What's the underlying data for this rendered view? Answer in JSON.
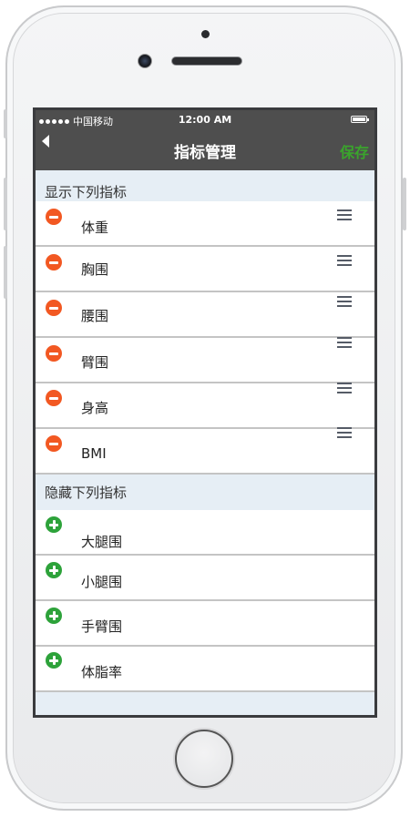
{
  "status_bar": {
    "carrier": "中国移动",
    "time": "12:00 AM"
  },
  "nav": {
    "title": "指标管理",
    "save_label": "保存"
  },
  "shown": {
    "header": "显示下列指标",
    "items": [
      {
        "label": "体重"
      },
      {
        "label": "胸围"
      },
      {
        "label": "腰围"
      },
      {
        "label": "臂围"
      },
      {
        "label": "身高"
      },
      {
        "label": "BMI"
      }
    ]
  },
  "hidden": {
    "header": "隐藏下列指标",
    "items": [
      {
        "label": "大腿围"
      },
      {
        "label": "小腿围"
      },
      {
        "label": "手臂围"
      },
      {
        "label": "体脂率"
      }
    ]
  },
  "colors": {
    "remove": "#f25822",
    "add": "#2da23a",
    "save": "#3aa52c",
    "header_bg": "#4e4e4e"
  }
}
